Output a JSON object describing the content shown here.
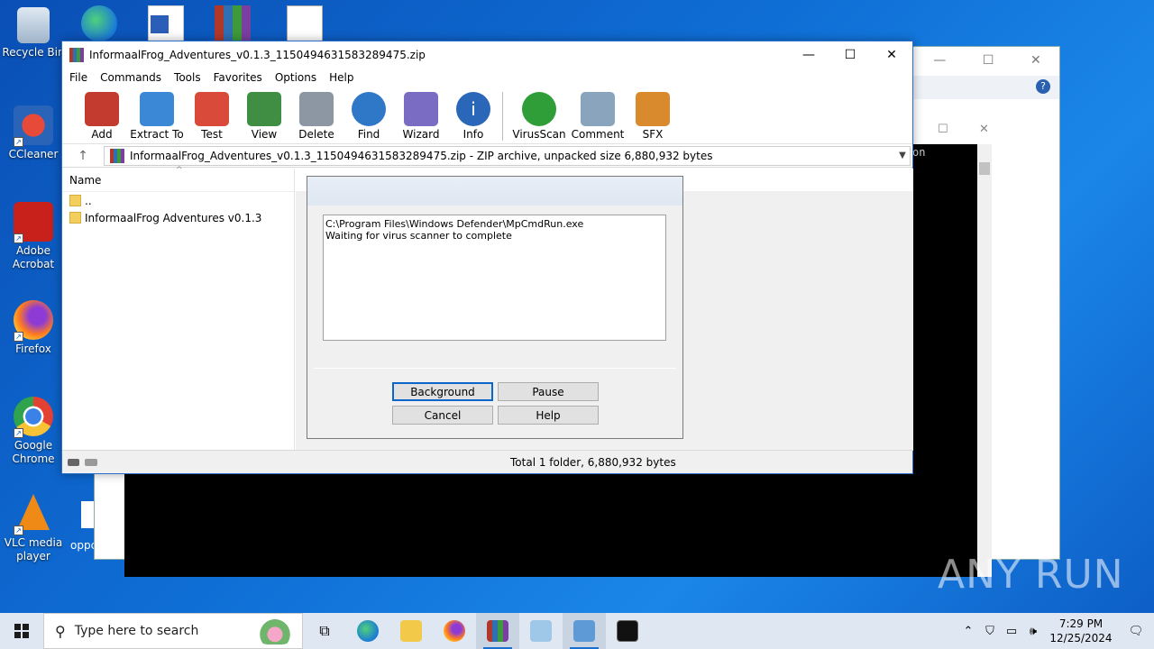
{
  "desktop": {
    "icons": [
      {
        "label": "Recycle Bin"
      },
      {
        "label": "CCleaner"
      },
      {
        "label": "Adobe Acrobat"
      },
      {
        "label": "Firefox"
      },
      {
        "label": "Google Chrome"
      },
      {
        "label": "VLC media player"
      }
    ],
    "partial_label": "oppc",
    "console_text": "on"
  },
  "winrar": {
    "title": "InformaalFrog_Adventures_v0.1.3_1150494631583289475.zip",
    "menu": [
      "File",
      "Commands",
      "Tools",
      "Favorites",
      "Options",
      "Help"
    ],
    "toolbar": [
      {
        "label": "Add",
        "color": "#c23b2e"
      },
      {
        "label": "Extract To",
        "color": "#3a88d6"
      },
      {
        "label": "Test",
        "color": "#d94a3a"
      },
      {
        "label": "View",
        "color": "#3f8e44"
      },
      {
        "label": "Delete",
        "color": "#8c97a3"
      },
      {
        "label": "Find",
        "color": "#2e78c7"
      },
      {
        "label": "Wizard",
        "color": "#7a6cc2"
      },
      {
        "label": "Info",
        "color": "#2a67b8"
      },
      {
        "label": "VirusScan",
        "color": "#2f9e38"
      },
      {
        "label": "Comment",
        "color": "#8aa4bd"
      },
      {
        "label": "SFX",
        "color": "#d88a2c"
      }
    ],
    "path": "InformaalFrog_Adventures_v0.1.3_1150494631583289475.zip - ZIP archive, unpacked size 6,880,932 bytes",
    "column_name": "Name",
    "files": [
      {
        "name": ".."
      },
      {
        "name": "InformaalFrog Adventures v0.1.3"
      }
    ],
    "status": "Total 1 folder, 6,880,932 bytes"
  },
  "dialog": {
    "log_lines": [
      "C:\\Program Files\\Windows Defender\\MpCmdRun.exe",
      "Waiting for virus scanner to complete"
    ],
    "buttons": {
      "background": "Background",
      "pause": "Pause",
      "cancel": "Cancel",
      "help": "Help"
    }
  },
  "taskbar": {
    "search_placeholder": "Type here to search",
    "time": "7:29 PM",
    "date": "12/25/2024"
  },
  "watermark": "ANY RUN"
}
